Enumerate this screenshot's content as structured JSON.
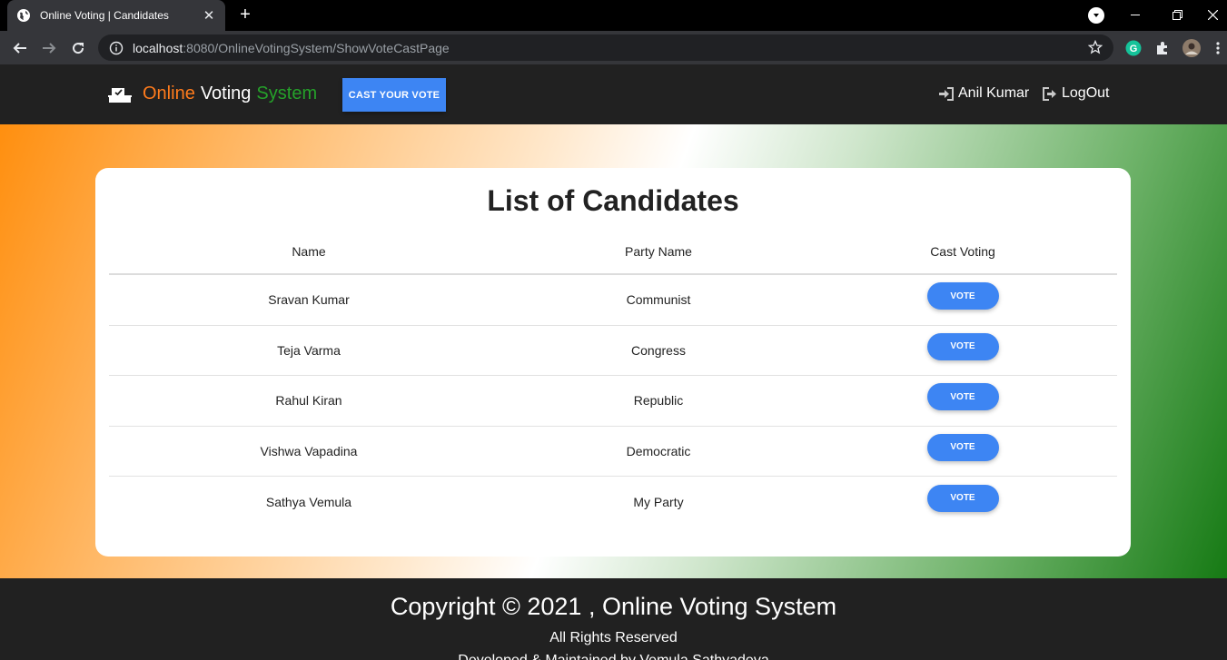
{
  "browser": {
    "tab_title": "Online Voting | Candidates",
    "tab_close": "✕",
    "new_tab": "+",
    "url_host": "localhost",
    "url_rest": ":8080/OnlineVotingSystem/ShowVoteCastPage"
  },
  "navbar": {
    "brand_part1": "Online",
    "brand_part2": "Voting",
    "brand_part3": "System",
    "cast_vote_label": "CAST YOUR VOTE",
    "user_name": "Anil Kumar",
    "logout_label": "LogOut"
  },
  "main": {
    "title": "List of Candidates",
    "columns": [
      "Name",
      "Party Name",
      "Cast Voting"
    ],
    "vote_label": "VOTE",
    "candidates": [
      {
        "name": "Sravan Kumar",
        "party": "Communist"
      },
      {
        "name": "Teja Varma",
        "party": "Congress"
      },
      {
        "name": "Rahul Kiran",
        "party": "Republic"
      },
      {
        "name": "Vishwa Vapadina",
        "party": "Democratic"
      },
      {
        "name": "Sathya Vemula",
        "party": "My Party"
      }
    ]
  },
  "footer": {
    "copyright": "Copyright © 2021 , Online Voting System",
    "rights": "All Rights Reserved",
    "developer": "Developed & Maintained by Vemula Sathyadeva"
  },
  "colors": {
    "brand_online": "#ff7b1c",
    "brand_system": "#25a12a",
    "primary_button": "#3d85f3",
    "navbar_bg": "#212121"
  }
}
